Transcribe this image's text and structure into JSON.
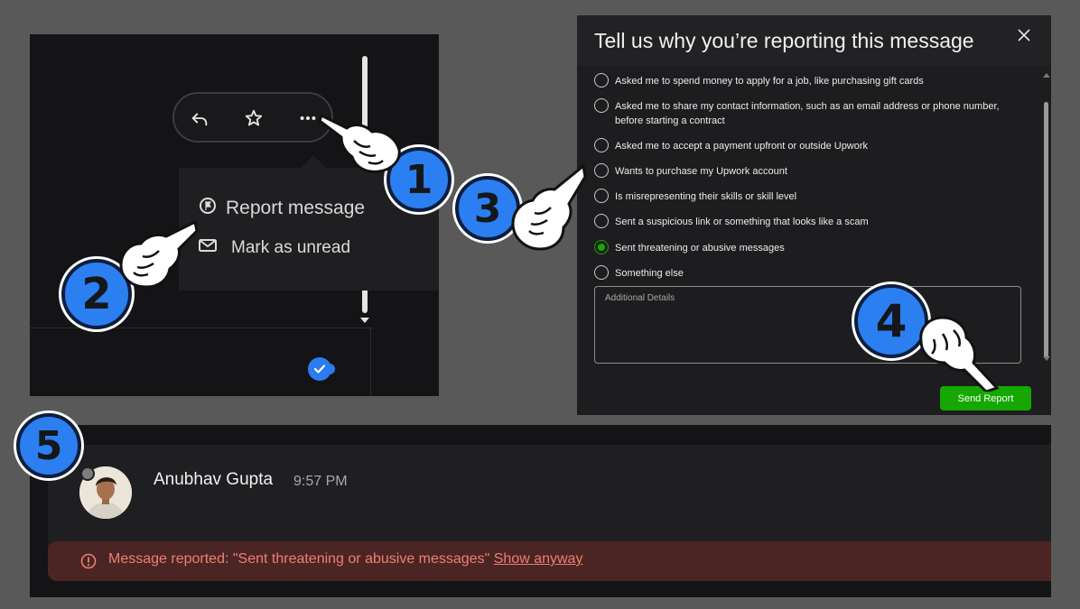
{
  "panel1": {
    "toolbar": {
      "icons": [
        "reply-icon",
        "star-icon",
        "more-icon"
      ]
    },
    "menu": {
      "report_label": "Report message",
      "unread_label": "Mark as unread"
    }
  },
  "panel2": {
    "title": "Tell us why you’re reporting this message",
    "options": [
      "Asked me to spend money to apply for a job, like purchasing gift cards",
      "Asked me to share my contact information, such as an email address or phone number, before starting a contract",
      "Asked me to accept a payment upfront or outside Upwork",
      "Wants to purchase my Upwork account",
      "Is misrepresenting their skills or skill level",
      "Sent a suspicious link or something that looks like a scam",
      "Sent threatening or abusive messages",
      "Something else"
    ],
    "selected_index": 6,
    "details_placeholder": "Additional Details",
    "send_label": "Send Report",
    "accent": "#14a800"
  },
  "panel3": {
    "name": "Anubhav Gupta",
    "time": "9:57 PM",
    "banner_text": "Message reported: \"Sent threatening or abusive messages\"",
    "banner_link": "Show anyway"
  },
  "steps": [
    "1",
    "2",
    "3",
    "4",
    "5"
  ]
}
